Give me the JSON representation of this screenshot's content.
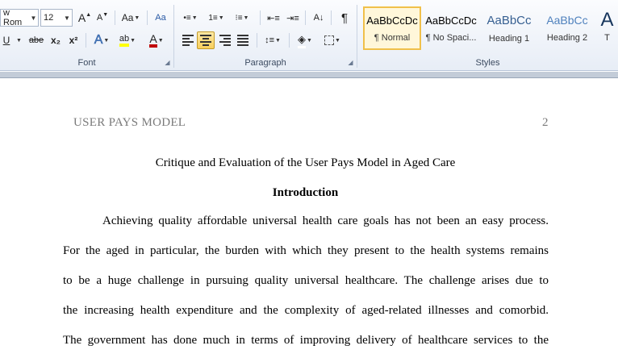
{
  "ribbon": {
    "font_group": {
      "label": "Font",
      "font_name": "w Rom",
      "font_size": "12",
      "grow_font": "A",
      "shrink_font": "A",
      "change_case": "Aa",
      "underline": "U",
      "strikethrough": "abe",
      "subscript": "x₂",
      "superscript": "x²",
      "text_effects": "A",
      "highlight": "ab",
      "font_color": "A"
    },
    "paragraph_group": {
      "label": "Paragraph",
      "sort": "A↓",
      "show_marks": "¶"
    },
    "styles_group": {
      "label": "Styles",
      "styles": [
        {
          "preview": "AaBbCcDc",
          "name": "¶ Normal"
        },
        {
          "preview": "AaBbCcDc",
          "name": "¶ No Spaci..."
        },
        {
          "preview": "AaBbCc",
          "name": "Heading 1"
        },
        {
          "preview": "AaBbCc",
          "name": "Heading 2"
        },
        {
          "preview": "A",
          "name": "T"
        }
      ]
    },
    "colors": {
      "highlight": "#ffff00",
      "font_color": "#c00000"
    }
  },
  "document": {
    "header_text": "USER PAYS MODEL",
    "page_number": "2",
    "title": "Critique and Evaluation of the User Pays Model in Aged Care",
    "heading": "Introduction",
    "lines": [
      "Achieving quality affordable universal health care goals has not been an easy process.",
      "For the aged in particular, the burden with which they present to the health systems remains",
      "to be a huge challenge in pursuing quality universal healthcare. The challenge arises due to",
      "the increasing health expenditure and the complexity of aged-related illnesses and comorbid.",
      "The government has done much in terms of improving delivery of healthcare services to the"
    ]
  }
}
